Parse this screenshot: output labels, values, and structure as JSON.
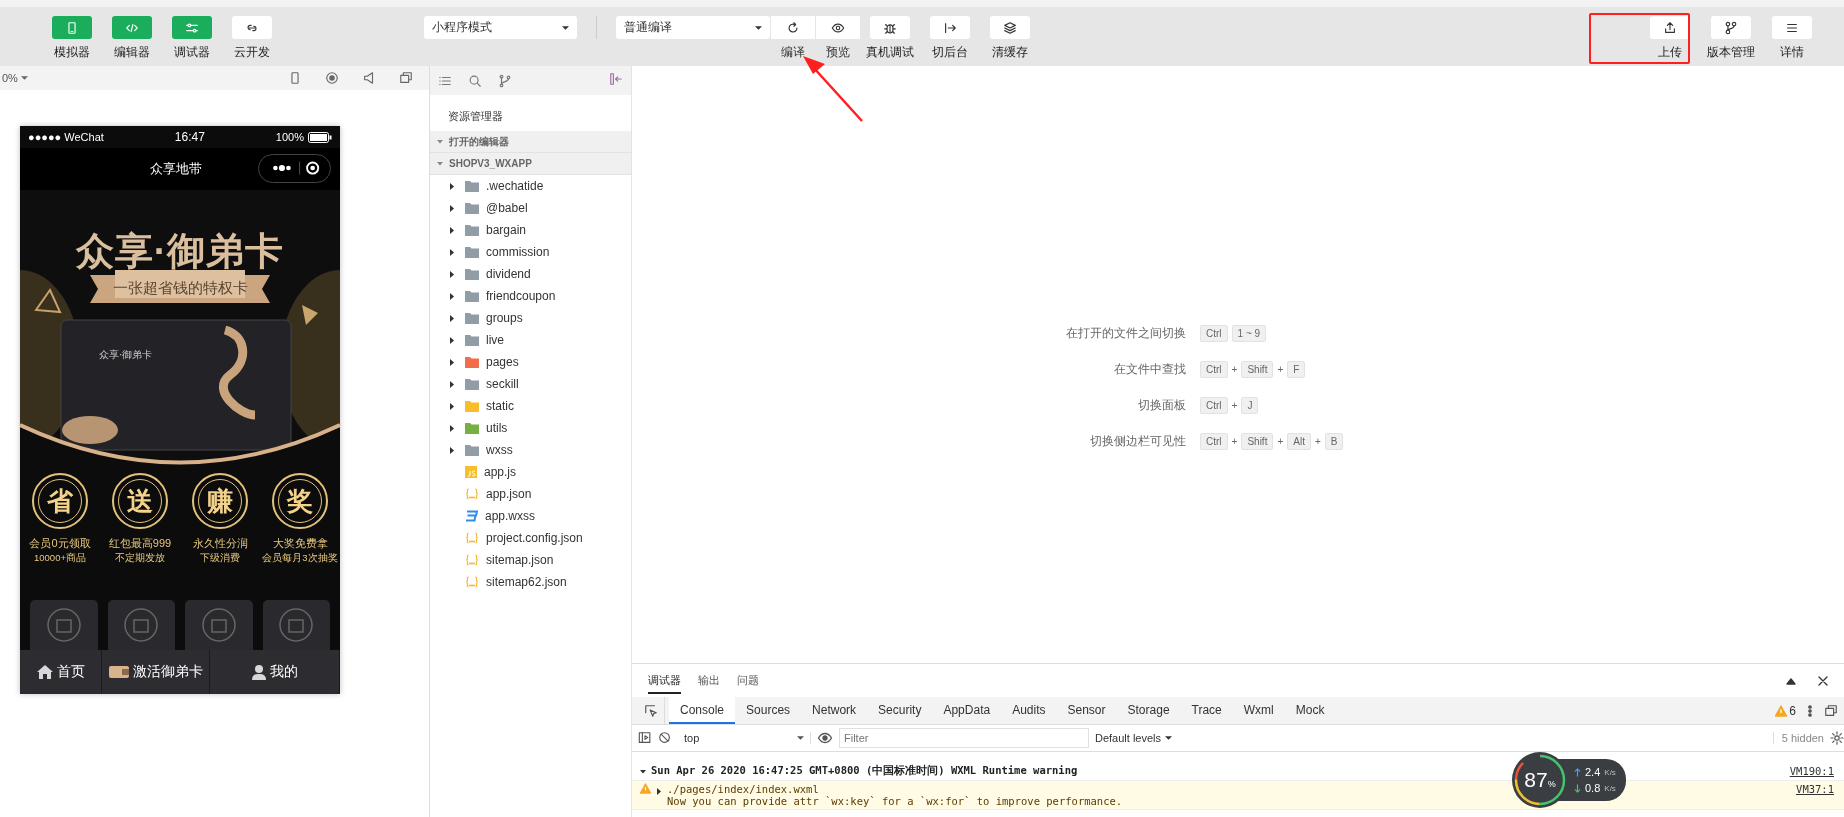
{
  "toolbar": {
    "left_tools": [
      {
        "kind": "phone",
        "label": "模拟器",
        "on": true
      },
      {
        "kind": "code",
        "label": "编辑器",
        "on": true
      },
      {
        "kind": "sliders",
        "label": "调试器",
        "on": true
      },
      {
        "kind": "cloud",
        "label": "云开发",
        "on": false
      }
    ],
    "mode_select": {
      "value": "小程序模式"
    },
    "compile_select": {
      "value": "普通编译"
    },
    "compile_tools": [
      {
        "kind": "refresh",
        "label": "编译"
      },
      {
        "kind": "eye",
        "label": "预览"
      }
    ],
    "tools": [
      {
        "kind": "bug",
        "label": "真机调试"
      },
      {
        "kind": "switch",
        "label": "切后台"
      },
      {
        "kind": "layers",
        "label": "清缓存"
      }
    ],
    "right_tools": [
      {
        "kind": "upload",
        "label": "上传"
      },
      {
        "kind": "branch",
        "label": "版本管理"
      },
      {
        "kind": "menu",
        "label": "详情"
      }
    ]
  },
  "simulator": {
    "zoom": "0%",
    "phone": {
      "carrier": "●●●●● WeChat",
      "time": "16:47",
      "battery": "100%",
      "nav_title": "众享地带",
      "banner_title": "众享·御弟卡",
      "banner_ribbon": "一张超省钱的特权卡",
      "card_label": "众享·御弟卡",
      "benefits": [
        {
          "glyph": "省",
          "title": "会员0元领取",
          "note": "10000+商品"
        },
        {
          "glyph": "送",
          "title": "红包最高999",
          "note": "不定期发放"
        },
        {
          "glyph": "赚",
          "title": "永久性分润",
          "note": "下级消费"
        },
        {
          "glyph": "奖",
          "title": "大奖免费拿",
          "note": "会员每月3次抽奖"
        }
      ],
      "tabs": [
        {
          "kind": "home",
          "label": "首页"
        },
        {
          "kind": "card",
          "label": "激活御弟卡"
        },
        {
          "kind": "person",
          "label": "我的"
        }
      ]
    }
  },
  "explorer": {
    "title": "资源管理器",
    "sections": [
      {
        "label": "打开的编辑器",
        "expanded": true
      },
      {
        "label": "SHOPV3_WXAPP",
        "expanded": true,
        "children": [
          {
            "kind": "folder",
            "name": ".wechatide",
            "expanded": false,
            "color": "#909ca6"
          },
          {
            "kind": "folder",
            "name": "@babel",
            "expanded": false,
            "color": "#909ca6"
          },
          {
            "kind": "folder",
            "name": "bargain",
            "expanded": false,
            "color": "#909ca6"
          },
          {
            "kind": "folder",
            "name": "commission",
            "expanded": false,
            "color": "#909ca6"
          },
          {
            "kind": "folder",
            "name": "dividend",
            "expanded": false,
            "color": "#909ca6"
          },
          {
            "kind": "folder",
            "name": "friendcoupon",
            "expanded": false,
            "color": "#909ca6"
          },
          {
            "kind": "folder",
            "name": "groups",
            "expanded": false,
            "color": "#909ca6"
          },
          {
            "kind": "folder",
            "name": "live",
            "expanded": false,
            "color": "#909ca6"
          },
          {
            "kind": "folder",
            "name": "pages",
            "expanded": false,
            "color": "#f26b4b"
          },
          {
            "kind": "folder",
            "name": "seckill",
            "expanded": false,
            "color": "#909ca6"
          },
          {
            "kind": "folder",
            "name": "static",
            "expanded": false,
            "color": "#f9bd2c"
          },
          {
            "kind": "folder",
            "name": "utils",
            "expanded": false,
            "color": "#76b043"
          },
          {
            "kind": "folder",
            "name": "wxss",
            "expanded": false,
            "color": "#909ca6"
          },
          {
            "kind": "js",
            "name": "app.js"
          },
          {
            "kind": "json",
            "name": "app.json"
          },
          {
            "kind": "css",
            "name": "app.wxss"
          },
          {
            "kind": "json",
            "name": "project.config.json"
          },
          {
            "kind": "json",
            "name": "sitemap.json"
          },
          {
            "kind": "json",
            "name": "sitemap62.json"
          }
        ]
      }
    ]
  },
  "editor": {
    "shortcuts": [
      {
        "label": "在打开的文件之间切换",
        "keys": [
          {
            "kind": "key",
            "text": "Ctrl"
          },
          {
            "kind": "key",
            "text": "1 ~ 9"
          }
        ]
      },
      {
        "label": "在文件中查找",
        "keys": [
          {
            "kind": "key",
            "text": "Ctrl"
          },
          {
            "kind": "plus",
            "text": "+"
          },
          {
            "kind": "key",
            "text": "Shift"
          },
          {
            "kind": "plus",
            "text": "+"
          },
          {
            "kind": "key",
            "text": "F"
          }
        ]
      },
      {
        "label": "切换面板",
        "keys": [
          {
            "kind": "key",
            "text": "Ctrl"
          },
          {
            "kind": "plus",
            "text": "+"
          },
          {
            "kind": "key",
            "text": "J"
          }
        ]
      },
      {
        "label": "切换侧边栏可见性",
        "keys": [
          {
            "kind": "key",
            "text": "Ctrl"
          },
          {
            "kind": "plus",
            "text": "+"
          },
          {
            "kind": "key",
            "text": "Shift"
          },
          {
            "kind": "plus",
            "text": "+"
          },
          {
            "kind": "key",
            "text": "Alt"
          },
          {
            "kind": "plus",
            "text": "+"
          },
          {
            "kind": "key",
            "text": "B"
          }
        ]
      }
    ]
  },
  "devtools": {
    "panel_tabs": [
      {
        "label": "调试器",
        "selected": true
      },
      {
        "label": "输出",
        "selected": false
      },
      {
        "label": "问题",
        "selected": false
      }
    ],
    "tabs": [
      {
        "label": "Console",
        "selected": true
      },
      {
        "label": "Sources",
        "selected": false
      },
      {
        "label": "Network",
        "selected": false
      },
      {
        "label": "Security",
        "selected": false
      },
      {
        "label": "AppData",
        "selected": false
      },
      {
        "label": "Audits",
        "selected": false
      },
      {
        "label": "Sensor",
        "selected": false
      },
      {
        "label": "Storage",
        "selected": false
      },
      {
        "label": "Trace",
        "selected": false
      },
      {
        "label": "Wxml",
        "selected": false
      },
      {
        "label": "Mock",
        "selected": false
      }
    ],
    "warning_count": "6",
    "context": "top",
    "filter_placeholder": "Filter",
    "levels": "Default levels",
    "hidden": "5 hidden",
    "log": [
      {
        "kind": "group",
        "expanded": true,
        "text": "Sun Apr 26 2020 16:47:25 GMT+0800 (中国标准时间) WXML Runtime warning",
        "source": "VM190:1"
      },
      {
        "kind": "warning",
        "expanded": false,
        "text": "./pages/index/index.wxml",
        "detail": "Now you can provide attr `wx:key` for a `wx:for` to improve performance.",
        "source": "VM37:1"
      }
    ]
  },
  "network_meter": {
    "percent": "87",
    "percent_unit": "%",
    "up": "2.4",
    "up_unit": "K/s",
    "down": "0.8",
    "down_unit": "K/s"
  }
}
